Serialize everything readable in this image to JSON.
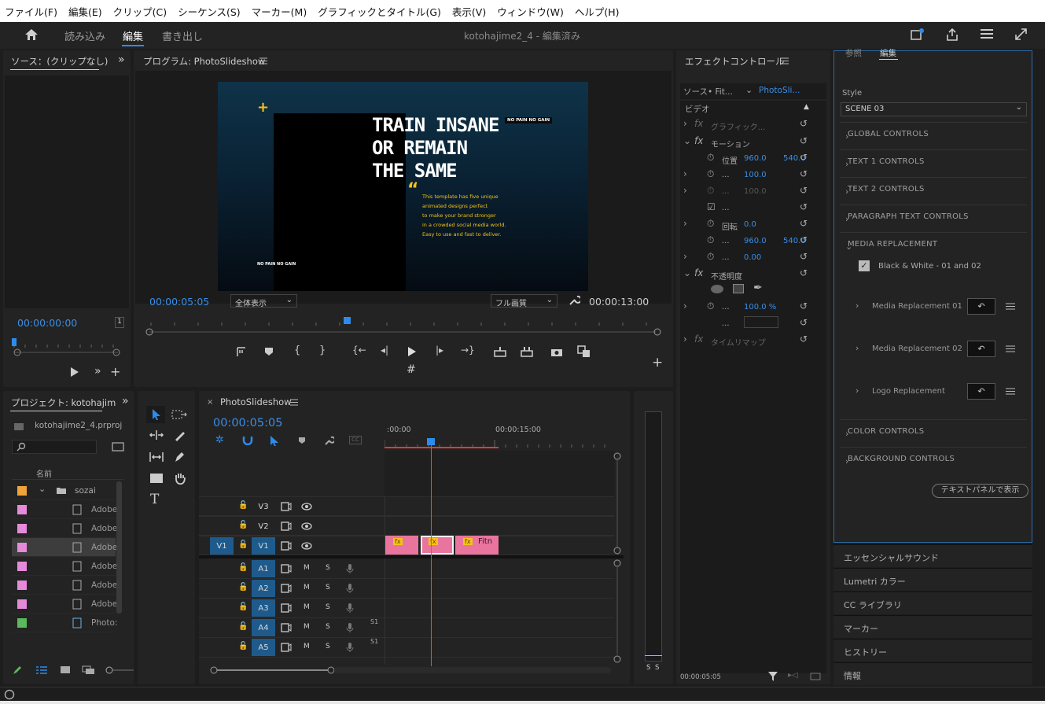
{
  "menu": [
    "ファイル(F)",
    "編集(E)",
    "クリップ(C)",
    "シーケンス(S)",
    "マーカー(M)",
    "グラフィックとタイトル(G)",
    "表示(V)",
    "ウィンドウ(W)",
    "ヘルプ(H)"
  ],
  "workspace": {
    "tabs": [
      "読み込み",
      "編集",
      "書き出し"
    ],
    "active": "編集",
    "title": "kotohajime2_4 - 編集済み"
  },
  "source": {
    "title": "ソース：(クリップなし)",
    "timecode": "00:00:00:00",
    "zoom": "1"
  },
  "program": {
    "title": "プログラム: PhotoSlideshow",
    "timecode": "00:00:05:05",
    "fit": "全体表示",
    "quality": "フル画質",
    "duration": "00:00:13:00",
    "preview": {
      "headline1": "TRAIN INSANE",
      "headline2": "OR REMAIN",
      "headline3": "THE SAME",
      "tag": "NO PAIN NO GAIN",
      "tag2": "NO PAIN NO GAIN",
      "body1": "This template has five unique",
      "body2": "animated designs perfect",
      "body3": "to make your brand stronger",
      "body4": "in a crowded social media world.",
      "body5": "Easy to use and fast to deliver."
    }
  },
  "effects": {
    "title": "エフェクトコントロール",
    "source": "ソース• Fit...",
    "seq": "PhotoSli...",
    "video": "ビデオ",
    "graphic": "グラフィック...",
    "motion": "モーション",
    "pos_label": "位置",
    "pos_x": "960.0",
    "pos_y": "540.0",
    "scale_label": "...",
    "scale": "100.0",
    "scale_w": "100.0",
    "uniform": "...",
    "rot_label": "回転",
    "rot": "0.0",
    "anchor_label": "...",
    "anchor_x": "960.0",
    "anchor_y": "540.0",
    "flicker_label": "...",
    "flicker": "0.00",
    "opacity": "不透明度",
    "opacity_label": "...",
    "opacity_val": "100.0 %",
    "blend_label": "...",
    "blend": "...",
    "remap": "タイムリマップ",
    "timecode": "00:00:05:05"
  },
  "egp": {
    "tab1": "参照",
    "tab2": "編集",
    "style_label": "Style",
    "style_value": "SCENE 03",
    "sections": [
      "GLOBAL CONTROLS",
      "TEXT 1 CONTROLS",
      "TEXT 2 CONTROLS",
      "PARAGRAPH TEXT CONTROLS",
      "MEDIA REPLACEMENT"
    ],
    "checkbox": "Black & White - 01 and 02",
    "media": [
      "Media Replacement 01",
      "Media Replacement 02",
      "Logo Replacement"
    ],
    "sections2": [
      "COLOR CONTROLS",
      "BACKGROUND CONTROLS"
    ],
    "button": "テキストパネルで表示"
  },
  "panels": [
    "エッセンシャルサウンド",
    "Lumetri カラー",
    "CC ライブラリ",
    "マーカー",
    "ヒストリー",
    "情報"
  ],
  "project": {
    "title": "プロジェクト: kotohajim",
    "file": "kotohajime2_4.prproj",
    "col": "名前",
    "folder": "sozai",
    "items": [
      "Adobe",
      "Adobe",
      "Adobe",
      "Adobe",
      "Adobe",
      "Adobe",
      "Photo:"
    ],
    "colors": [
      "#f0a33a",
      "#e58ad8",
      "#e58ad8",
      "#e58ad8",
      "#e58ad8",
      "#e58ad8",
      "#e58ad8",
      "#5cb85c"
    ]
  },
  "timeline": {
    "title": "PhotoSlideshow",
    "timecode": "00:00:05:05",
    "t0": ":00:00",
    "t1": "00:00:15:00",
    "video_tracks": [
      "V3",
      "V2",
      "V1"
    ],
    "audio_tracks": [
      "A1",
      "A2",
      "A3",
      "A4",
      "A5"
    ],
    "src_v": "V1",
    "m": "M",
    "s": "S",
    "clip_fx": "fx",
    "clip_label": "Fitn",
    "audio_num": "S1"
  },
  "meter": {
    "s1": "S",
    "s2": "S"
  }
}
